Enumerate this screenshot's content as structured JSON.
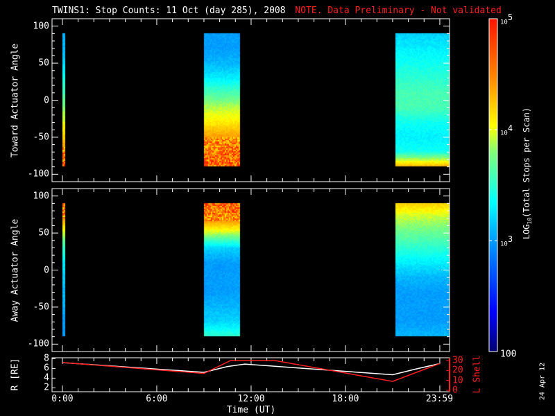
{
  "title": "TWINS1: Stop Counts: 11 Oct (day 285), 2008",
  "note": "NOTE. Data Preliminary - Not validated",
  "date_stamp": "24 Apr 12",
  "colors": {
    "note": "#ff2020",
    "lshell": "#ff2020",
    "r": "#ffffff"
  },
  "chart_data": [
    {
      "type": "heatmap",
      "name": "toward",
      "ylabel": "Toward Actuator Angle",
      "ylim": [
        -110,
        110
      ],
      "yticks": [
        "100",
        "50",
        "0",
        "-50",
        "-100"
      ],
      "ytick_values": [
        100,
        50,
        0,
        -50,
        -100
      ],
      "angle_bins": [
        90,
        70,
        50,
        30,
        10,
        -10,
        -30,
        -50,
        -70,
        -88
      ],
      "blocks": [
        {
          "t0": 0.0,
          "t1": 0.2,
          "log_counts": [
            3.1,
            3.1,
            3.2,
            3.4,
            3.6,
            3.8,
            4.0,
            4.2,
            4.5,
            4.7
          ]
        },
        {
          "t0": 9.0,
          "t1": 11.3,
          "log_counts": [
            3.0,
            3.0,
            3.1,
            3.3,
            3.6,
            3.9,
            4.1,
            4.4,
            4.6,
            4.6
          ]
        },
        {
          "t0": 21.2,
          "t1": 24.6,
          "log_counts": [
            3.2,
            3.3,
            3.4,
            3.5,
            3.6,
            3.6,
            3.4,
            3.3,
            3.4,
            4.3
          ]
        }
      ]
    },
    {
      "type": "heatmap",
      "name": "away",
      "ylabel": "Away Actuator Angle",
      "ylim": [
        -110,
        110
      ],
      "yticks": [
        "100",
        "50",
        "0",
        "-50",
        "-100"
      ],
      "ytick_values": [
        100,
        50,
        0,
        -50,
        -100
      ],
      "angle_bins": [
        90,
        70,
        50,
        30,
        10,
        -10,
        -30,
        -50,
        -70,
        -88
      ],
      "blocks": [
        {
          "t0": 0.0,
          "t1": 0.2,
          "log_counts": [
            4.6,
            4.4,
            3.9,
            3.5,
            3.3,
            3.2,
            3.1,
            3.1,
            3.0,
            3.0
          ]
        },
        {
          "t0": 9.0,
          "t1": 11.3,
          "log_counts": [
            4.6,
            4.5,
            3.9,
            3.2,
            3.0,
            3.0,
            3.0,
            3.1,
            3.2,
            3.5
          ]
        },
        {
          "t0": 21.2,
          "t1": 24.6,
          "log_counts": [
            4.2,
            3.9,
            3.7,
            3.5,
            3.3,
            3.1,
            3.0,
            3.0,
            3.0,
            3.1
          ]
        }
      ]
    },
    {
      "type": "line",
      "name": "orbit",
      "ylabel": "R [RE]",
      "y2label": "L Shell",
      "ylim": [
        1.2,
        8.2
      ],
      "y2lim": [
        0,
        30
      ],
      "yticks": [
        "8",
        "6",
        "4",
        "2"
      ],
      "ytick_values": [
        8,
        6,
        4,
        2
      ],
      "y2ticks": [
        "30",
        "20",
        "10",
        "0"
      ],
      "y2tick_values": [
        30,
        20,
        10,
        0
      ],
      "xlabel": "Time (UT)",
      "xticks": [
        "0:00",
        "6:00",
        "12:00",
        "18:00",
        "23:59"
      ],
      "xtick_values": [
        0,
        6,
        12,
        18,
        23.98
      ],
      "series": [
        {
          "name": "R",
          "x": [
            0,
            9,
            10.5,
            11.6,
            15,
            21,
            22.5,
            24
          ],
          "y": [
            7.2,
            5.2,
            6.4,
            6.9,
            6.1,
            4.7,
            5.9,
            7.0
          ]
        },
        {
          "name": "L Shell",
          "x": [
            0,
            9,
            10.7,
            13.5,
            21,
            24
          ],
          "y": [
            28,
            17,
            30,
            30,
            9,
            27
          ]
        }
      ]
    }
  ],
  "colorbar": {
    "label": "LOG10(Total Stops per Scan)",
    "label_prefix": "LOG",
    "label_sub": "10",
    "label_suffix": "(Total Stops per Scan)",
    "range_log": [
      2,
      5
    ],
    "ticks": [
      {
        "base": "10",
        "exp": "5",
        "value": 5
      },
      {
        "base": "10",
        "exp": "4",
        "value": 4
      },
      {
        "base": "10",
        "exp": "3",
        "value": 3
      },
      {
        "base": "100",
        "exp": "",
        "value": 2
      }
    ]
  }
}
